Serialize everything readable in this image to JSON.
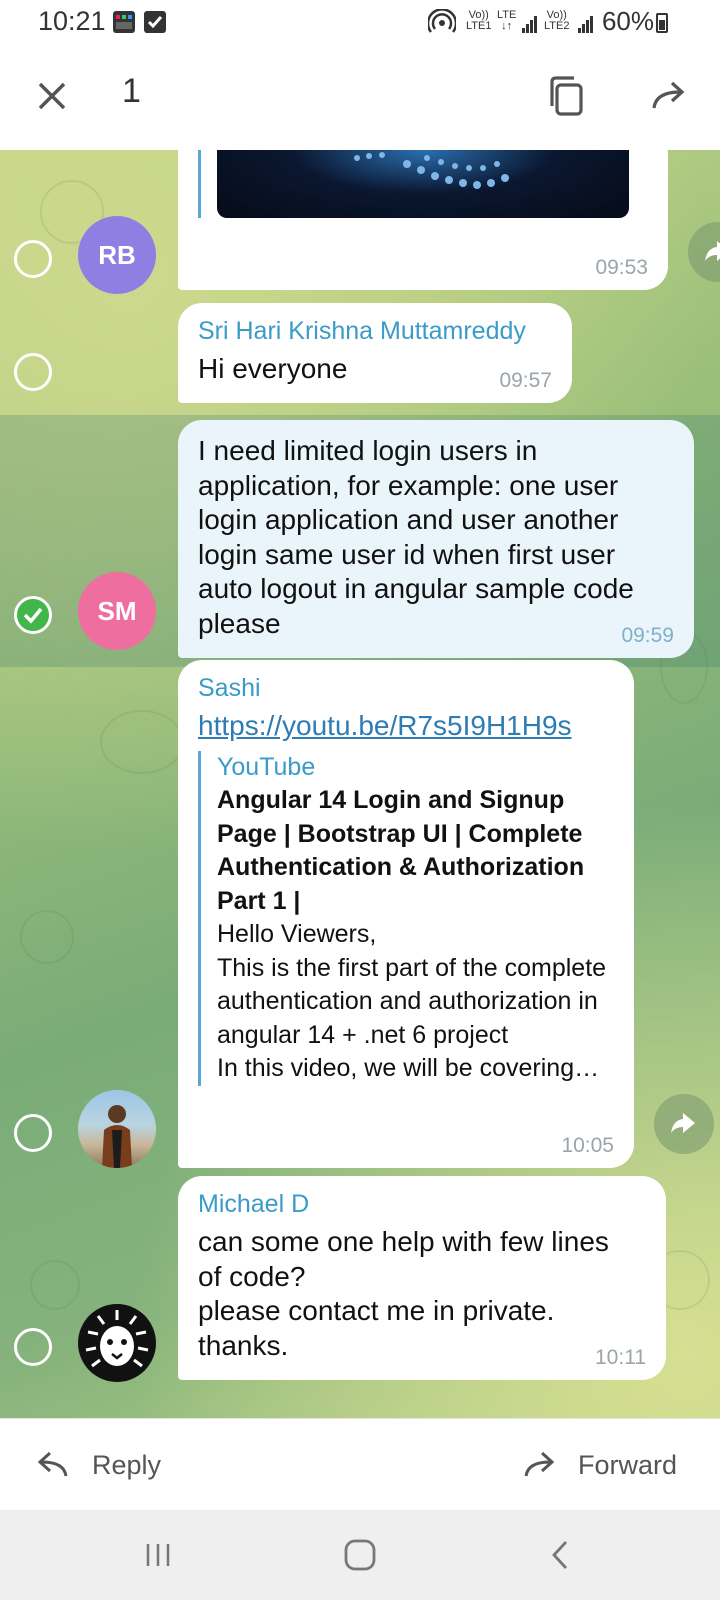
{
  "status_bar": {
    "time": "10:21",
    "sim1_label_top": "Vo))",
    "sim1_label_bottom": "LTE1",
    "lte_label": "LTE",
    "sim2_label_top": "Vo))",
    "sim2_label_bottom": "LTE2",
    "battery": "60%"
  },
  "action_bar": {
    "selected_count": "1"
  },
  "messages": [
    {
      "avatar_initials": "RB",
      "avatar_color": "#8f7fe3",
      "time": "09:53",
      "selected": false
    },
    {
      "sender": "Sri Hari Krishna Muttamreddy",
      "text": "Hi everyone",
      "time": "09:57",
      "selected": false
    },
    {
      "avatar_initials": "SM",
      "avatar_color": "#ee6f9f",
      "text": "I need limited login users in\napplication, for example: one user\nlogin application and user another\nlogin same user id  when first user\nauto logout in angular sample code\nplease",
      "time": "09:59",
      "selected": true
    },
    {
      "sender": "Sashi",
      "link": "https://youtu.be/R7s5I9H1H9s",
      "preview_site": "YouTube",
      "preview_title": "Angular 14 Login and Signup Page | Bootstrap UI | Complete Authentication & Authorization Part 1 |",
      "preview_desc": "Hello Viewers,\nThis is the first part of the complete authentication and authorization in angular 14 + .net 6 project\nIn this video, we will be covering…",
      "time": "10:05",
      "selected": false
    },
    {
      "sender": "Michael D",
      "text": "can some one help with few lines\nof code?\nplease contact me in private.\nthanks.",
      "time": "10:11",
      "selected": false
    }
  ],
  "bottom_bar": {
    "reply_label": "Reply",
    "forward_label": "Forward"
  },
  "colors": {
    "accent": "#3a9bc9",
    "checked": "#42b64a"
  }
}
